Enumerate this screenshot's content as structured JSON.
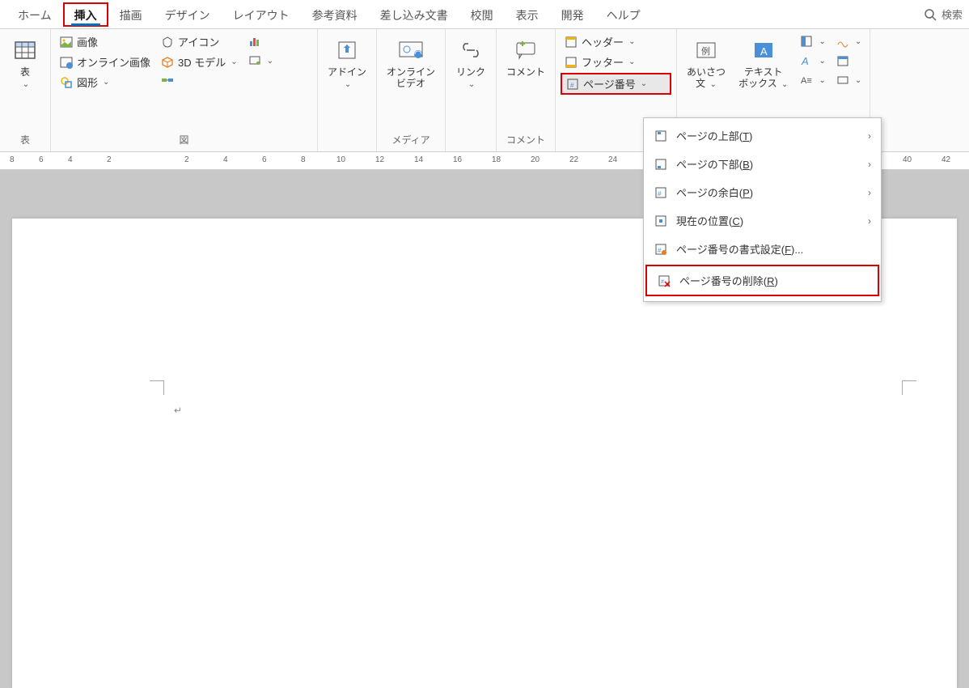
{
  "tabs": {
    "items": [
      "ホーム",
      "挿入",
      "描画",
      "デザイン",
      "レイアウト",
      "参考資料",
      "差し込み文書",
      "校閲",
      "表示",
      "開発",
      "ヘルプ"
    ],
    "active": "挿入",
    "search_label": "検索"
  },
  "ribbon": {
    "table": {
      "label": "表",
      "group_label": "表"
    },
    "illustrations": {
      "image": "画像",
      "online_images": "オンライン画像",
      "shapes": "図形",
      "icons": "アイコン",
      "models_3d": "3D モデル",
      "smartart": "",
      "chart_small": "",
      "screenshot": "",
      "group_label": "図"
    },
    "addins": {
      "label": "アドイン",
      "group_label": ""
    },
    "media": {
      "online_video": "オンライン\nビデオ",
      "group_label": "メディア"
    },
    "links": {
      "label": "リンク",
      "group_label": ""
    },
    "comments": {
      "label": "コメント",
      "group_label": "コメント"
    },
    "headerfooter": {
      "header": "ヘッダー",
      "footer": "フッター",
      "page_number": "ページ番号",
      "group_label": ""
    },
    "text": {
      "greeting": "あいさつ\n文",
      "textbox": "テキスト\nボックス",
      "group_label": ""
    }
  },
  "page_number_menu": {
    "top": {
      "label": "ページの上部(",
      "key": "T",
      "suffix": ")"
    },
    "bottom": {
      "label": "ページの下部(",
      "key": "B",
      "suffix": ")"
    },
    "margins": {
      "label": "ページの余白(",
      "key": "P",
      "suffix": ")"
    },
    "current": {
      "label": "現在の位置(",
      "key": "C",
      "suffix": ")"
    },
    "format": {
      "label": "ページ番号の書式設定(",
      "key": "F",
      "suffix": ")..."
    },
    "remove": {
      "label": "ページ番号の削除(",
      "key": "R",
      "suffix": ")"
    }
  },
  "ruler_marks": [
    "8",
    "6",
    "4",
    "2",
    "2",
    "4",
    "6",
    "8",
    "10",
    "12",
    "14",
    "16",
    "18",
    "20",
    "22",
    "24",
    "40",
    "42"
  ]
}
